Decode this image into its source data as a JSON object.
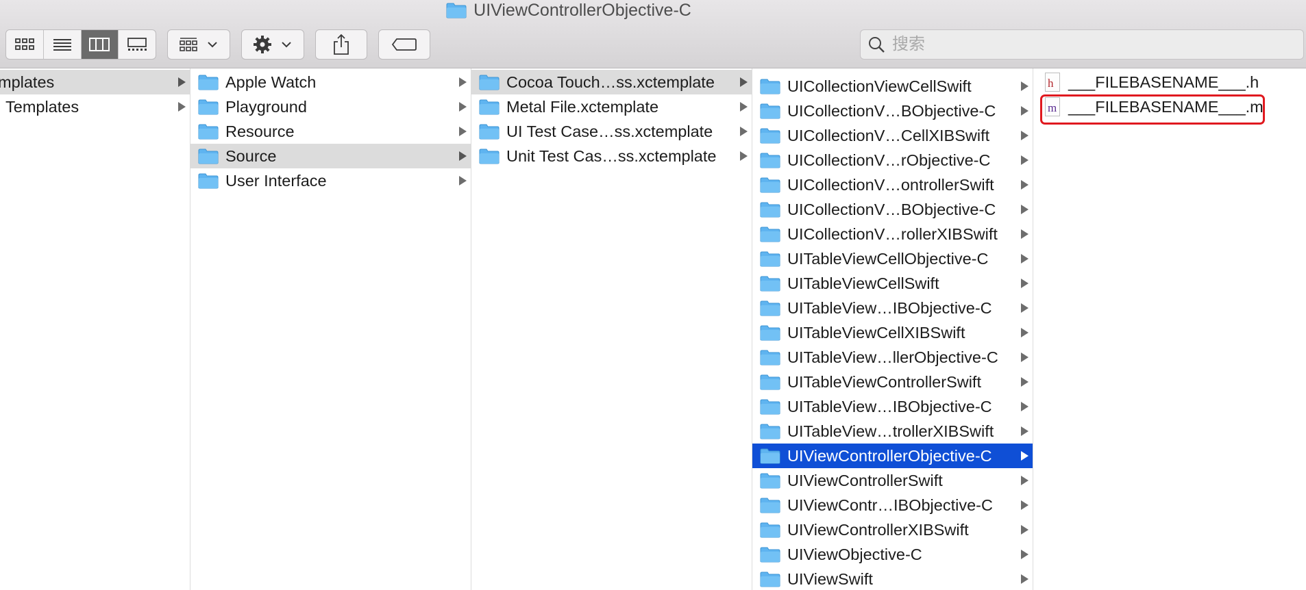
{
  "window": {
    "title": "UIViewControllerObjective-C"
  },
  "toolbar": {
    "view_buttons": [
      "icon-view-icon",
      "list-view-icon",
      "column-view-icon",
      "gallery-view-icon"
    ],
    "active_view": "column",
    "group_button_icon": "group-grid-icon",
    "action_button_icon": "gear-icon",
    "share_button_icon": "share-icon",
    "tag_button_icon": "tag-icon",
    "search_placeholder": "搜索"
  },
  "columns": [
    {
      "items": [
        {
          "label": "mplates",
          "has_children": true,
          "state": "gray"
        },
        {
          "label": "Templates",
          "has_children": true,
          "state": "none"
        }
      ]
    },
    {
      "items": [
        {
          "label": "Apple Watch",
          "has_children": true,
          "state": "none"
        },
        {
          "label": "Playground",
          "has_children": true,
          "state": "none"
        },
        {
          "label": "Resource",
          "has_children": true,
          "state": "none"
        },
        {
          "label": "Source",
          "has_children": true,
          "state": "gray"
        },
        {
          "label": "User Interface",
          "has_children": true,
          "state": "none"
        }
      ]
    },
    {
      "items": [
        {
          "label": "Cocoa Touch…ss.xctemplate",
          "has_children": true,
          "state": "gray"
        },
        {
          "label": "Metal File.xctemplate",
          "has_children": true,
          "state": "none"
        },
        {
          "label": "UI Test Case…ss.xctemplate",
          "has_children": true,
          "state": "none"
        },
        {
          "label": "Unit Test Cas…ss.xctemplate",
          "has_children": true,
          "state": "none"
        }
      ]
    },
    {
      "items": [
        {
          "label": "UICollectionViewCellSwift",
          "has_children": true,
          "state": "none"
        },
        {
          "label": "UICollectionV…BObjective-C",
          "has_children": true,
          "state": "none"
        },
        {
          "label": "UICollectionV…CellXIBSwift",
          "has_children": true,
          "state": "none"
        },
        {
          "label": "UICollectionV…rObjective-C",
          "has_children": true,
          "state": "none"
        },
        {
          "label": "UICollectionV…ontrollerSwift",
          "has_children": true,
          "state": "none"
        },
        {
          "label": "UICollectionV…BObjective-C",
          "has_children": true,
          "state": "none"
        },
        {
          "label": "UICollectionV…rollerXIBSwift",
          "has_children": true,
          "state": "none"
        },
        {
          "label": "UITableViewCellObjective-C",
          "has_children": true,
          "state": "none"
        },
        {
          "label": "UITableViewCellSwift",
          "has_children": true,
          "state": "none"
        },
        {
          "label": "UITableView…IBObjective-C",
          "has_children": true,
          "state": "none"
        },
        {
          "label": "UITableViewCellXIBSwift",
          "has_children": true,
          "state": "none"
        },
        {
          "label": "UITableView…llerObjective-C",
          "has_children": true,
          "state": "none"
        },
        {
          "label": "UITableViewControllerSwift",
          "has_children": true,
          "state": "none"
        },
        {
          "label": "UITableView…IBObjective-C",
          "has_children": true,
          "state": "none"
        },
        {
          "label": "UITableView…trollerXIBSwift",
          "has_children": true,
          "state": "none"
        },
        {
          "label": "UIViewControllerObjective-C",
          "has_children": true,
          "state": "selected"
        },
        {
          "label": "UIViewControllerSwift",
          "has_children": true,
          "state": "none"
        },
        {
          "label": "UIViewContr…IBObjective-C",
          "has_children": true,
          "state": "none"
        },
        {
          "label": "UIViewControllerXIBSwift",
          "has_children": true,
          "state": "none"
        },
        {
          "label": "UIViewObjective-C",
          "has_children": true,
          "state": "none"
        },
        {
          "label": "UIViewSwift",
          "has_children": true,
          "state": "none"
        }
      ]
    },
    {
      "files": [
        {
          "label": "___FILEBASENAME___.h",
          "icon_letter": "h",
          "icon_color": "#b2262c",
          "highlighted": false
        },
        {
          "label": "___FILEBASENAME___.m",
          "icon_letter": "m",
          "icon_color": "#5b2d91",
          "highlighted": true
        }
      ]
    }
  ],
  "colors": {
    "selection": "#0f4fd6",
    "inactive_selection": "#dcdcdc",
    "folder": "#5fb4f0",
    "annotation": "#e0191f"
  }
}
